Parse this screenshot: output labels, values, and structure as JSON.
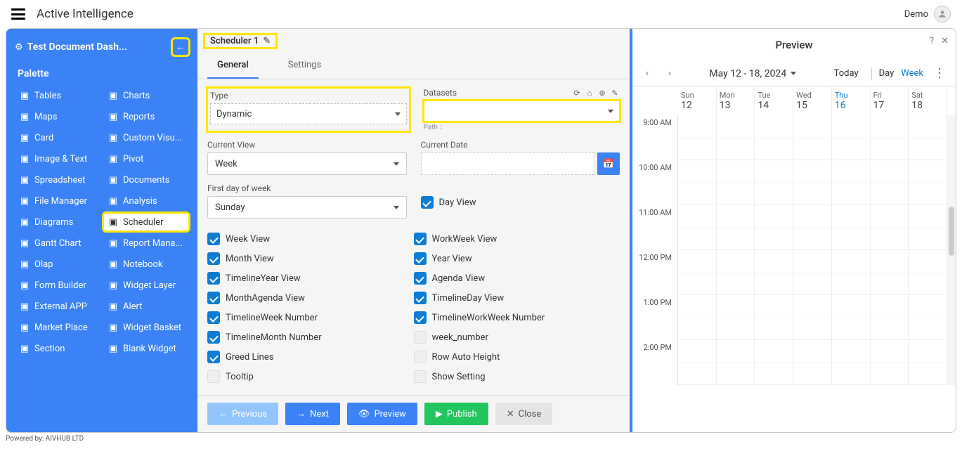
{
  "brand": "Active Intelligence",
  "user": "Demo",
  "sidebar": {
    "title": "Test Document Dash...",
    "palette_label": "Palette",
    "items": [
      {
        "label": "Tables",
        "selected": false
      },
      {
        "label": "Charts",
        "selected": false
      },
      {
        "label": "Maps",
        "selected": false
      },
      {
        "label": "Reports",
        "selected": false
      },
      {
        "label": "Card",
        "selected": false
      },
      {
        "label": "Custom Visu...",
        "selected": false
      },
      {
        "label": "Image & Text",
        "selected": false
      },
      {
        "label": "Pivot",
        "selected": false
      },
      {
        "label": "Spreadsheet",
        "selected": false
      },
      {
        "label": "Documents",
        "selected": false
      },
      {
        "label": "File Manager",
        "selected": false
      },
      {
        "label": "Analysis",
        "selected": false
      },
      {
        "label": "Diagrams",
        "selected": false
      },
      {
        "label": "Scheduler",
        "selected": true
      },
      {
        "label": "Gantt Chart",
        "selected": false
      },
      {
        "label": "Report Mana...",
        "selected": false
      },
      {
        "label": "Olap",
        "selected": false
      },
      {
        "label": "Notebook",
        "selected": false
      },
      {
        "label": "Form Builder",
        "selected": false
      },
      {
        "label": "Widget Layer",
        "selected": false
      },
      {
        "label": "External APP",
        "selected": false
      },
      {
        "label": "Alert",
        "selected": false
      },
      {
        "label": "Market Place",
        "selected": false
      },
      {
        "label": "Widget Basket",
        "selected": false
      },
      {
        "label": "Section",
        "selected": false
      },
      {
        "label": "Blank Widget",
        "selected": false
      }
    ]
  },
  "editor": {
    "title": "Scheduler 1",
    "tabs": {
      "general": "General",
      "settings": "Settings"
    },
    "type_label": "Type",
    "type_value": "Dynamic",
    "datasets_label": "Datasets",
    "path_label": "Path :.",
    "currentview_label": "Current View",
    "currentview_value": "Week",
    "currentdate_label": "Current Date",
    "firstday_label": "First day of week",
    "firstday_value": "Sunday",
    "checks": [
      {
        "label": "Day View",
        "on": true
      },
      {
        "label": "Week View",
        "on": true
      },
      {
        "label": "WorkWeek View",
        "on": true
      },
      {
        "label": "Month View",
        "on": true
      },
      {
        "label": "Year View",
        "on": true
      },
      {
        "label": "TimelineYear View",
        "on": true
      },
      {
        "label": "Agenda View",
        "on": true
      },
      {
        "label": "MonthAgenda View",
        "on": true
      },
      {
        "label": "TimelineDay View",
        "on": true
      },
      {
        "label": "TimelineWeek Number",
        "on": true
      },
      {
        "label": "TimelineWorkWeek Number",
        "on": true
      },
      {
        "label": "TimelineMonth Number",
        "on": true
      },
      {
        "label": "week_number",
        "on": false
      },
      {
        "label": "Greed Lines",
        "on": true
      },
      {
        "label": "Row Auto Height",
        "on": false
      },
      {
        "label": "Tooltip",
        "on": false
      },
      {
        "label": "Show Setting",
        "on": false
      }
    ]
  },
  "buttons": {
    "previous": "Previous",
    "next": "Next",
    "preview": "Preview",
    "publish": "Publish",
    "close": "Close"
  },
  "preview": {
    "title": "Preview",
    "date_range": "May 12 - 18, 2024",
    "today": "Today",
    "day": "Day",
    "week": "Week",
    "days": [
      {
        "name": "Sun",
        "num": "12",
        "active": false
      },
      {
        "name": "Mon",
        "num": "13",
        "active": false
      },
      {
        "name": "Tue",
        "num": "14",
        "active": false
      },
      {
        "name": "Wed",
        "num": "15",
        "active": false
      },
      {
        "name": "Thu",
        "num": "16",
        "active": true
      },
      {
        "name": "Fri",
        "num": "17",
        "active": false
      },
      {
        "name": "Sat",
        "num": "18",
        "active": false
      }
    ],
    "times": [
      "9:00 AM",
      "10:00 AM",
      "11:00 AM",
      "12:00 PM",
      "1:00 PM",
      "2:00 PM"
    ]
  },
  "footer": "Powered by: AIVHUB LTD"
}
